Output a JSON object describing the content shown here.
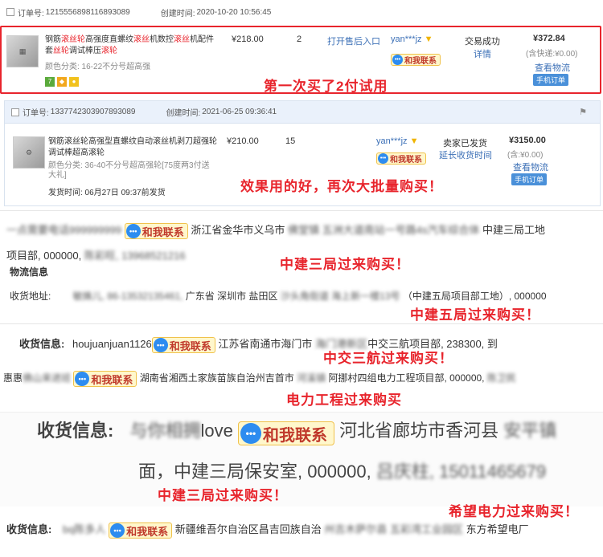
{
  "order1": {
    "order_label": "订单号:",
    "order_no": "1215556898116893089",
    "created_label": "创建时间:",
    "created_time": "2020-10-20 10:56:45",
    "title_parts": [
      "钢筋",
      "滚丝轮",
      "高强度直螺纹",
      "滚丝",
      "机数控",
      "滚丝",
      "机配件套",
      "丝轮",
      "调试棒压",
      "滚轮"
    ],
    "spec": "颜色分类: 16-22不分号超高强",
    "price": "¥218.00",
    "qty": "2",
    "after_sale": "打开售后入口",
    "seller": "yan***jz",
    "chat": "和我联系",
    "status": "交易成功",
    "detail": "详情",
    "total": "¥372.84",
    "shipping": "(含快递:¥0.00)",
    "logistics": "查看物流",
    "mobile_order": "手机订单",
    "annotation": "第一次买了2付试用"
  },
  "order2": {
    "order_label": "订单号:",
    "order_no": "1337742303907893089",
    "created_label": "创建时间:",
    "created_time": "2021-06-25 09:36:41",
    "title": "钢筋滚丝轮高强型直螺纹自动滚丝机剥刀超强轮调试棒超高滚轮",
    "spec": "颜色分类: 36-40不分号超高强轮[75度两3付送大礼]",
    "ship_time": "发货时间:  06月27日 09:37前发货",
    "price": "¥210.00",
    "qty": "15",
    "seller": "yan***jz",
    "chat": "和我联系",
    "status": "卖家已发货",
    "extend": "延长收货时间",
    "total": "¥3150.00",
    "shipping": "(含:¥0.00)",
    "logistics": "查看物流",
    "mobile_order": "手机订单",
    "annotation": "效果用的好，再次大批量购买！"
  },
  "record1": {
    "name": "一点需要电话999999999",
    "chat": "和我联系",
    "address": "浙江省金华市义乌市",
    "blur_part": "佛堂镇 五洲大道南站一号路4s汽车综合体",
    "tail": "中建三局工地",
    "line2": "项目部, 000000,",
    "blur2": "陈彩旺, 13968521216",
    "annotation": "中建三局过来购买！"
  },
  "record2": {
    "section": "物流信息",
    "label": "收货地址:",
    "blur": "敏姝儿, 86-13532135461,",
    "address": "广东省 深圳市 盐田区",
    "blur2": "沙头角街道 海上新一楼13号",
    "tail": "（中建五局项目部工地）, 000000",
    "annotation": "中建五局过来购买！"
  },
  "record3": {
    "label": "收货信息:",
    "name": "houjuanjuan1126",
    "chat": "和我联系",
    "address": "江苏省南通市海门市",
    "blur": "海门港新区",
    "tail": "中交三航项目部, 238300, 到",
    "annotation": "中交三航过来购买！"
  },
  "record4": {
    "name": "惠惠",
    "blur": "佛山来进班",
    "chat": "和我联系",
    "address": "湖南省湘西土家族苗族自治州吉首市",
    "blur2": "河溪镇",
    "tail": "阿挪村四组电力工程项目部, 000000,",
    "blur3": "陈卫民",
    "annotation": "电力工程过来购买"
  },
  "record5": {
    "label": "收货信息:",
    "name_blur": "与你相拥",
    "name_tail": "love",
    "chat": "和我联系",
    "address": "河北省廊坊市香河县",
    "blur": "安平镇",
    "line2": "面，中建三局保安室, 000000,",
    "blur2": "吕庆柱, 15011465679",
    "annotation": "中建三局过来购买！"
  },
  "record6": {
    "label": "收货信息:",
    "name_blur": "bq陈多人",
    "chat": "和我联系",
    "address": "新疆维吾尔自治区昌吉回族自治",
    "blur": "州吉木萨尔县 五彩湾工业园区",
    "tail": "东方希望电厂",
    "annotation": "希望电力过来购买！"
  }
}
